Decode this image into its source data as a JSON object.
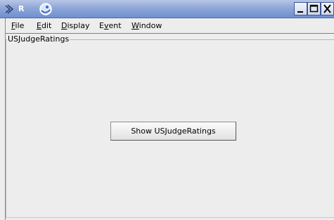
{
  "window": {
    "logo_letter": "R",
    "controls": [
      "minimize",
      "maximize",
      "close"
    ]
  },
  "menu": {
    "items": [
      {
        "label": "File",
        "underline": "F",
        "rest": "ile"
      },
      {
        "label": "Edit",
        "underline": "E",
        "rest": "dit"
      },
      {
        "label": "Display",
        "underline": "D",
        "rest": "isplay"
      },
      {
        "label": "Event",
        "pre": "E",
        "underline": "v",
        "rest": "ent"
      },
      {
        "label": "Window",
        "underline": "W",
        "rest": "indow"
      }
    ]
  },
  "panel": {
    "title": "USJudgeRatings",
    "button_label": "Show USJudgeRatings"
  },
  "colors": {
    "titlebar_start": "#b7c6e6",
    "titlebar_end": "#6f8fcf",
    "background": "#ededed"
  }
}
